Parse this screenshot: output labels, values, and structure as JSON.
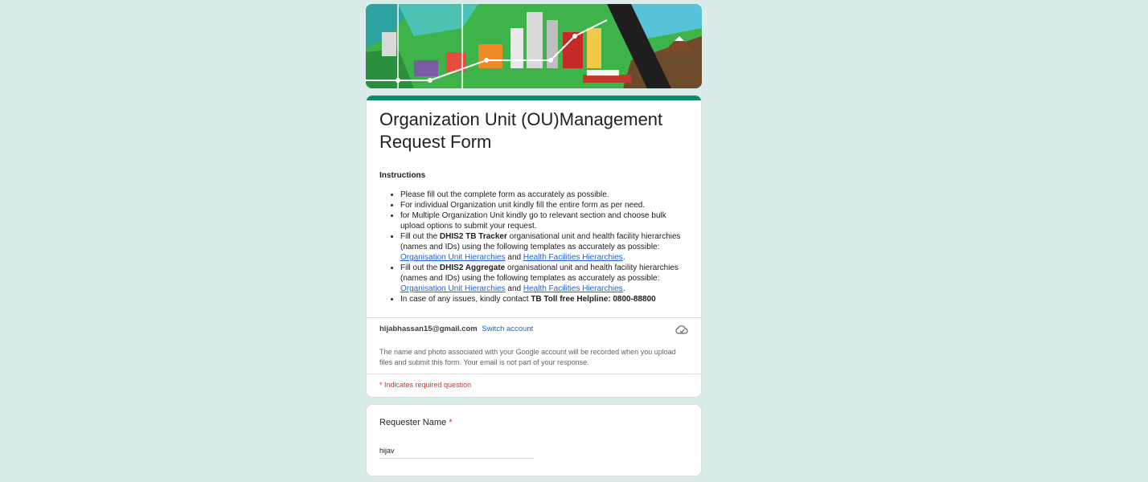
{
  "form": {
    "title": "Organization Unit (OU)Management Request Form",
    "instructions_heading": "Instructions",
    "bullets": {
      "b1": "Please fill out the complete form as accurately as possible.",
      "b2": "For individual Organization unit kindly fill the entire form as per need.",
      "b3": "for Multiple Organization Unit kindly go to relevant section and choose bulk upload options to submit your request.",
      "b4_pre": "Fill out the ",
      "b4_bold": "DHIS2 TB Tracker",
      "b4_mid": " organisational unit and health facility hierarchies (names and IDs) using the following templates as accurately as possible: ",
      "b4_link1": "Organisation Unit Hierarchies",
      "b4_and": " and ",
      "b4_link2": "Health Facilities Hierarchies",
      "b4_end": ".",
      "b5_pre": "Fill out the ",
      "b5_bold": "DHIS2 Aggregate",
      "b5_mid": " organisational unit and health facility hierarchies (names and IDs) using the following templates as accurately as possible: ",
      "b5_link1": "Organisation Unit Hierarchies",
      "b5_and": " and ",
      "b5_link2": "Health Facilities Hierarchies",
      "b5_end": ".",
      "b6_pre": "In case of any issues, kindly contact ",
      "b6_bold": "TB Toll free Helpline: 0800-88800"
    }
  },
  "account": {
    "email": "hijabhassan15@gmail.com",
    "switch_label": "Switch account",
    "cloud_icon": "cloud-off-icon",
    "notice": "The name and photo associated with your Google account will be recorded when you upload files and submit this form. Your email is not part of your response."
  },
  "required_note": "* Indicates required question",
  "question": {
    "label": "Requester Name",
    "required_mark": "*",
    "value": "hijav"
  },
  "colors": {
    "page_bg": "#d9ecea",
    "accent": "#0a8a6f",
    "link": "#1a62d6",
    "required": "#d93025"
  }
}
